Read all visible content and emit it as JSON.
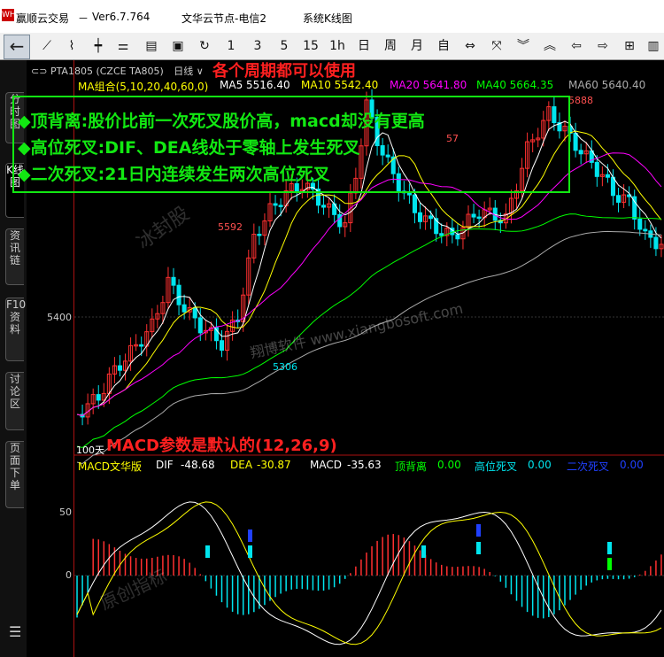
{
  "titlebar": {
    "logo": "WH",
    "app": "赢顺云交易",
    "dash": "－",
    "version": "Ver6.7.764",
    "node": "文华云节点-电信2",
    "window": "系统K线图"
  },
  "toolbar": {
    "back_icon": "←",
    "items": [
      "1",
      "3",
      "5",
      "15",
      "1h",
      "日",
      "周",
      "月",
      "自"
    ]
  },
  "sidebar": {
    "tabs": [
      "分时图",
      "K线图",
      "资讯链",
      "F10资料",
      "讨论区",
      "页面下单"
    ],
    "menu_icon": "☰"
  },
  "chart_header": {
    "symbol": "PTA1805 (CZCE TA805)",
    "period": "日线",
    "period_arrow": "∨"
  },
  "overlay": {
    "headline": "各个周期都可以使用",
    "lines": [
      "◆顶背离:股价比前一次死叉股价高，macd却没有更高",
      "◆高位死叉:DIF、DEA线处于零轴上发生死叉",
      "◆二次死叉:21日内连续发生两次高位死叉"
    ],
    "macd_note": "MACD参数是默认的(12,26,9)"
  },
  "ma_bar": {
    "label": "MA组合(5,10,20,40,60,0)",
    "ma5": "MA5 5516.40",
    "ma10": "MA10 5542.40",
    "ma20": "MA20 5641.80",
    "ma40": "MA40 5664.35",
    "ma60": "MA60 5640.40"
  },
  "price_axis": {
    "label": "5400"
  },
  "price_labels": {
    "high": "5888",
    "mid": "5592",
    "low": "5306",
    "partial": "57",
    "days": "100天"
  },
  "macd_bar": {
    "label": "MACD文华版",
    "dif_label": "DIF",
    "dif": "-48.68",
    "dea_label": "DEA",
    "dea": "-30.87",
    "macd_label": "MACD",
    "macd": "-35.63",
    "top_div_label": "顶背离",
    "top_div": "0.00",
    "high_cross_label": "高位死叉",
    "high_cross": "0.00",
    "second_cross_label": "二次死叉",
    "second_cross": "0.00"
  },
  "macd_axis": {
    "l50": "50",
    "l0": "0"
  },
  "watermarks": [
    "冰封股",
    "翔博软件  www.xiangbosoft.com",
    "原创指标"
  ],
  "colors": {
    "up": "#ff3030",
    "down": "#00e5ee",
    "ma5": "#ffffff",
    "ma10": "#ffff00",
    "ma20": "#ff00ff",
    "ma40": "#00ff00",
    "ma60": "#aaaaaa",
    "annotation": "#12e812"
  }
}
